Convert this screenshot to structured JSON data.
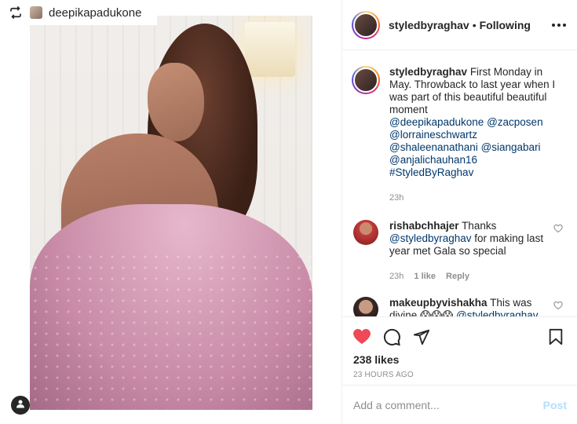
{
  "media": {
    "repost_user": "deepikapadukone",
    "photo_alt": ""
  },
  "post": {
    "username": "styledbyraghav",
    "separator": "•",
    "follow_status": "Following"
  },
  "caption": {
    "username": "styledbyraghav",
    "text": "First Monday in May. Throwback to last year when I was part of this beautiful beautiful moment",
    "mentions": [
      "@deepikapadukone",
      "@zacposen",
      "@lorraineschwartz",
      "@shaleenanathani",
      "@siangabari",
      "@anjalichauhan16",
      "#StyledByRaghav"
    ],
    "time": "23h"
  },
  "comments": [
    {
      "username": "rishabchhajer",
      "text_before": "Thanks",
      "mention": "@styledbyraghav",
      "text_after": "for making last year met Gala so special",
      "time": "23h",
      "likes": "1 like",
      "reply": "Reply"
    },
    {
      "username": "makeupbyvishakha",
      "text_before": "This was divine 😱😱😱",
      "mention": "@styledbyraghav",
      "text_after": ""
    }
  ],
  "engagement": {
    "likes": "238 likes",
    "time_ago": "23 HOURS AGO"
  },
  "composer": {
    "placeholder": "Add a comment...",
    "post_label": "Post"
  },
  "colors": {
    "like_red": "#ed4956",
    "link": "#00376b",
    "muted": "#8e8e8e",
    "post_disabled": "#b2dffc"
  },
  "icons": [
    "repost-icon",
    "more-options-icon",
    "heart-icon",
    "comment-icon",
    "share-icon",
    "bookmark-icon",
    "user-icon"
  ]
}
